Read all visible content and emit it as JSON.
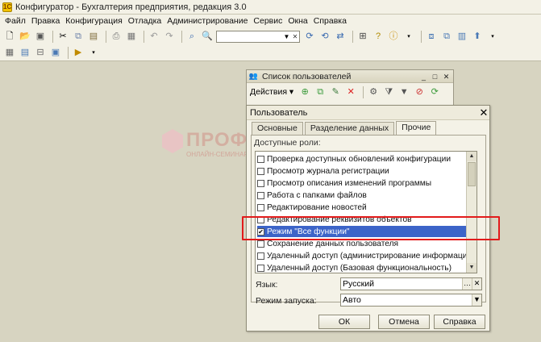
{
  "window": {
    "title": "Конфигуратор - Бухгалтерия предприятия, редакция 3.0"
  },
  "menu": [
    "Файл",
    "Правка",
    "Конфигурация",
    "Отладка",
    "Администрирование",
    "Сервис",
    "Окна",
    "Справка"
  ],
  "users_list": {
    "title": "Список пользователей",
    "actions_label": "Действия"
  },
  "watermark": {
    "brand": "ПРОФБУХ8.ру",
    "tagline": "ОНЛАЙН-СЕМИНАРЫ"
  },
  "dialog": {
    "title": "Пользователь",
    "tabs": [
      "Основные",
      "Разделение данных",
      "Прочие"
    ],
    "active_tab": "Прочие",
    "available_roles_label": "Доступные роли:",
    "roles": [
      {
        "label": "Проверка доступных обновлений конфигурации",
        "checked": false
      },
      {
        "label": "Просмотр журнала регистрации",
        "checked": false
      },
      {
        "label": "Просмотр описания изменений программы",
        "checked": false
      },
      {
        "label": "Работа с папками файлов",
        "checked": false
      },
      {
        "label": "Редактирование новостей",
        "checked": false
      },
      {
        "label": "Редактирование реквизитов объектов",
        "checked": false
      },
      {
        "label": "Режим \"Все функции\"",
        "checked": true,
        "selected": true
      },
      {
        "label": "Сохранение данных пользователя",
        "checked": false
      },
      {
        "label": "Удаленный доступ (администрирование информацион...",
        "checked": false
      },
      {
        "label": "Удаленный доступ (Базовая функциональность)",
        "checked": false
      }
    ],
    "language_label": "Язык:",
    "language_value": "Русский",
    "launch_mode_label": "Режим запуска:",
    "launch_mode_value": "Авто",
    "buttons": {
      "ok": "ОК",
      "cancel": "Отмена",
      "help": "Справка"
    }
  },
  "colors": {
    "selection": "#3c64c8",
    "highlight_box": "#e21b1b",
    "workspace": "#d7d4c1"
  }
}
